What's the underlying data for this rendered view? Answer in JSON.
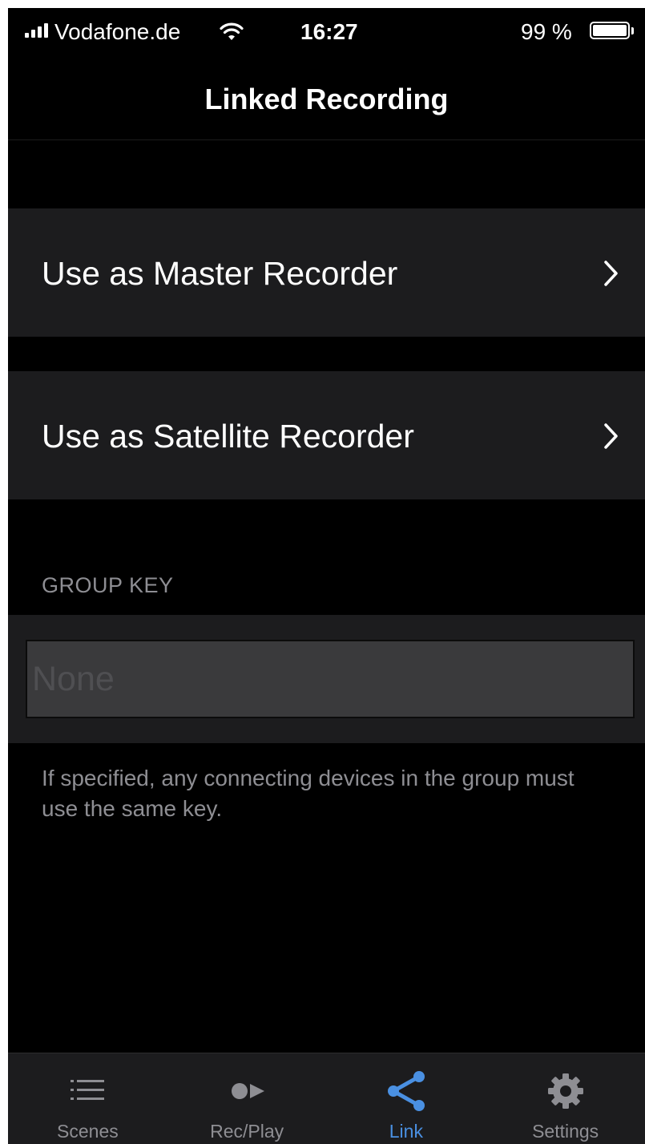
{
  "status_bar": {
    "carrier": "Vodafone.de",
    "time": "16:27",
    "battery_percent": "99 %",
    "battery_level": 0.99
  },
  "nav": {
    "title": "Linked Recording"
  },
  "rows": [
    {
      "label": "Use as Master Recorder",
      "icon": "chevron-right-icon"
    },
    {
      "label": "Use as Satellite Recorder",
      "icon": "chevron-right-icon"
    }
  ],
  "group_key": {
    "header": "GROUP KEY",
    "value": "",
    "placeholder": "None",
    "footnote": "If specified, any connecting devices in the group must use the same key."
  },
  "tab_bar": {
    "tabs": [
      {
        "label": "Scenes",
        "icon": "list-icon",
        "active": false
      },
      {
        "label": "Rec/Play",
        "icon": "record-play-icon",
        "active": false
      },
      {
        "label": "Link",
        "icon": "share-link-icon",
        "active": true
      },
      {
        "label": "Settings",
        "icon": "gear-icon",
        "active": false
      }
    ]
  },
  "colors": {
    "background": "#000000",
    "cell": "#1c1c1e",
    "input": "#3a3a3c",
    "secondary_text": "#8e8e93",
    "accent": "#4a90e2"
  }
}
